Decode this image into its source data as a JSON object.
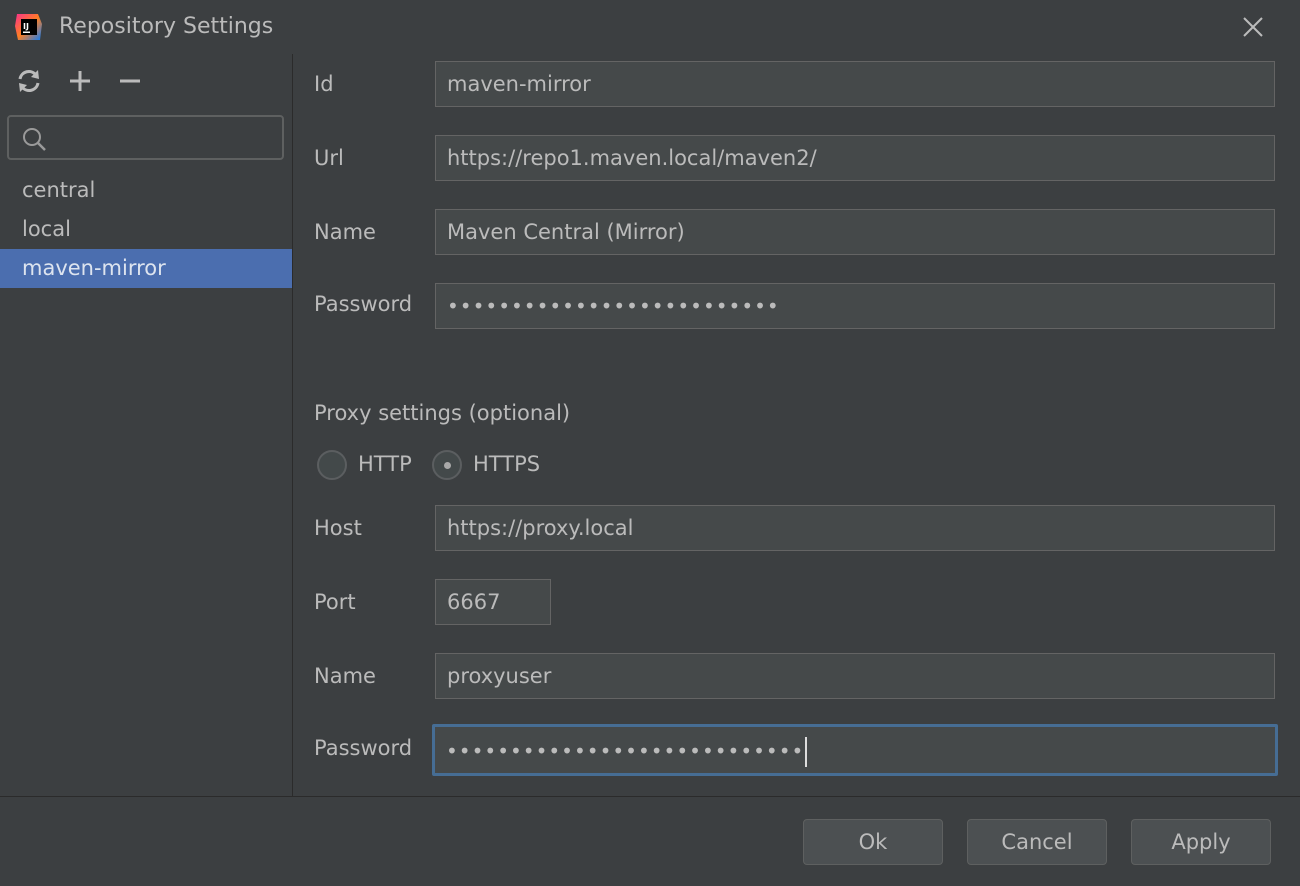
{
  "window": {
    "title": "Repository Settings",
    "app_icon": "intellij-idea-icon",
    "app_icon_text": "IJ"
  },
  "sidebar": {
    "toolbar": [
      {
        "icon": "refresh-icon"
      },
      {
        "icon": "plus-icon"
      },
      {
        "icon": "minus-icon"
      }
    ],
    "search": {
      "value": "",
      "placeholder": ""
    },
    "items": [
      {
        "label": "central",
        "selected": false
      },
      {
        "label": "local",
        "selected": false
      },
      {
        "label": "maven-mirror",
        "selected": true
      }
    ]
  },
  "repository": {
    "id_label": "Id",
    "id_value": "maven-mirror",
    "url_label": "Url",
    "url_value": "https://repo1.maven.local/maven2/",
    "name_label": "Name",
    "name_value": "Maven Central (Mirror)",
    "password_label": "Password",
    "password_value": "••••••••••••••••••••••••••"
  },
  "proxy": {
    "section_title": "Proxy settings (optional)",
    "protocol_options": [
      {
        "label": "HTTP",
        "selected": false
      },
      {
        "label": "HTTPS",
        "selected": true
      }
    ],
    "host_label": "Host",
    "host_value": "https://proxy.local",
    "port_label": "Port",
    "port_value": "6667",
    "name_label": "Name",
    "name_value": "proxyuser",
    "password_label": "Password",
    "password_value": "••••••••••••••••••••••••••••"
  },
  "footer": {
    "ok_label": "Ok",
    "cancel_label": "Cancel",
    "apply_label": "Apply"
  },
  "colors": {
    "background": "#3c3f41",
    "field_background": "#45494a",
    "selection": "#4b6eaf",
    "focus_border": "#466d94",
    "text": "#bbbbbb"
  }
}
